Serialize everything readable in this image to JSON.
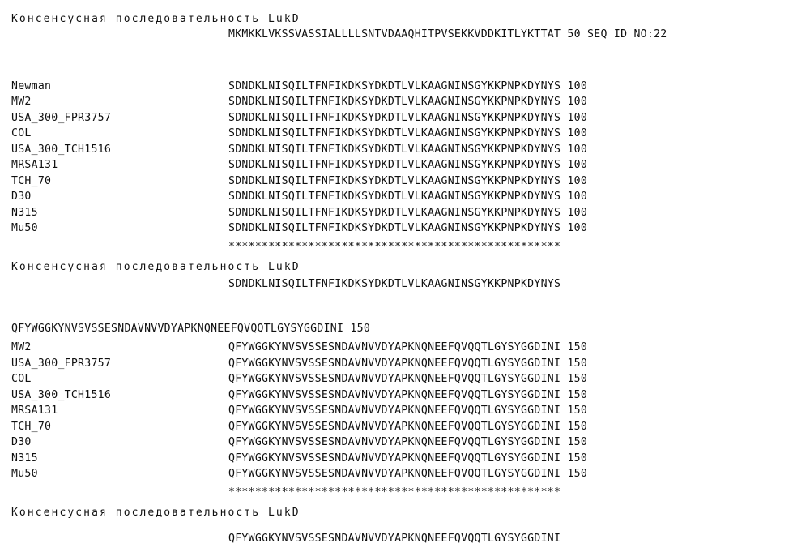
{
  "document": {
    "type": "sequence-alignment",
    "protein": "LukD",
    "consensus_heading": "Консенсусная последовательность LukD",
    "conservation_marker": "*",
    "conservation_line_length": 50
  },
  "block1": {
    "heading": "Консенсусная последовательность LukD",
    "header_sequence": "MKMKKLVKSSVASSIALLLLSNTVDAAQHITPVSEKKVDDKITLYKTTAT",
    "header_position": "50",
    "header_annotation": "SEQ ID NO:22",
    "rows": [
      {
        "label": "Newman",
        "sequence": "SDNDKLNISQILTFNFIKDKSYDKDTLVLKAAGNINSGYKKPNPKDYNYS",
        "position": "100"
      },
      {
        "label": "MW2",
        "sequence": "SDNDKLNISQILTFNFIKDKSYDKDTLVLKAAGNINSGYKKPNPKDYNYS",
        "position": "100"
      },
      {
        "label": "USA_300_FPR3757",
        "sequence": "SDNDKLNISQILTFNFIKDKSYDKDTLVLKAAGNINSGYKKPNPKDYNYS",
        "position": "100"
      },
      {
        "label": "COL",
        "sequence": "SDNDKLNISQILTFNFIKDKSYDKDTLVLKAAGNINSGYKKPNPKDYNYS",
        "position": "100"
      },
      {
        "label": "USA_300_TCH1516",
        "sequence": "SDNDKLNISQILTFNFIKDKSYDKDTLVLKAAGNINSGYKKPNPKDYNYS",
        "position": "100"
      },
      {
        "label": "MRSA131",
        "sequence": "SDNDKLNISQILTFNFIKDKSYDKDTLVLKAAGNINSGYKKPNPKDYNYS",
        "position": "100"
      },
      {
        "label": "TCH_70",
        "sequence": "SDNDKLNISQILTFNFIKDKSYDKDTLVLKAAGNINSGYKKPNPKDYNYS",
        "position": "100"
      },
      {
        "label": "D30",
        "sequence": "SDNDKLNISQILTFNFIKDKSYDKDTLVLKAAGNINSGYKKPNPKDYNYS",
        "position": "100"
      },
      {
        "label": "N315",
        "sequence": "SDNDKLNISQILTFNFIKDKSYDKDTLVLKAAGNINSGYKKPNPKDYNYS",
        "position": "100"
      },
      {
        "label": "Mu50",
        "sequence": "SDNDKLNISQILTFNFIKDKSYDKDTLVLKAAGNINSGYKKPNPKDYNYS",
        "position": "100"
      }
    ],
    "conservation": "**************************************************",
    "consensus_heading_bottom": "Консенсусная последовательность LukD",
    "consensus_sequence": "SDNDKLNISQILTFNFIKDKSYDKDTLVLKAAGNINSGYKKPNPKDYNYS"
  },
  "block2": {
    "header_sequence": "QFYWGGKYNVSVSSESNDAVNVVDYAPKNQNEEFQVQQTLGYSYGGDINI",
    "header_position": "150",
    "rows": [
      {
        "label": "MW2",
        "sequence": "QFYWGGKYNVSVSSESNDAVNVVDYAPKNQNEEFQVQQTLGYSYGGDINI",
        "position": "150"
      },
      {
        "label": "USA_300_FPR3757",
        "sequence": "QFYWGGKYNVSVSSESNDAVNVVDYAPKNQNEEFQVQQTLGYSYGGDINI",
        "position": "150"
      },
      {
        "label": "COL",
        "sequence": "QFYWGGKYNVSVSSESNDAVNVVDYAPKNQNEEFQVQQTLGYSYGGDINI",
        "position": "150"
      },
      {
        "label": "USA_300_TCH1516",
        "sequence": "QFYWGGKYNVSVSSESNDAVNVVDYAPKNQNEEFQVQQTLGYSYGGDINI",
        "position": "150"
      },
      {
        "label": "MRSA131",
        "sequence": "QFYWGGKYNVSVSSESNDAVNVVDYAPKNQNEEFQVQQTLGYSYGGDINI",
        "position": "150"
      },
      {
        "label": "TCH_70",
        "sequence": "QFYWGGKYNVSVSSESNDAVNVVDYAPKNQNEEFQVQQTLGYSYGGDINI",
        "position": "150"
      },
      {
        "label": "D30",
        "sequence": "QFYWGGKYNVSVSSESNDAVNVVDYAPKNQNEEFQVQQTLGYSYGGDINI",
        "position": "150"
      },
      {
        "label": "N315",
        "sequence": "QFYWGGKYNVSVSSESNDAVNVVDYAPKNQNEEFQVQQTLGYSYGGDINI",
        "position": "150"
      },
      {
        "label": "Mu50",
        "sequence": "QFYWGGKYNVSVSSESNDAVNVVDYAPKNQNEEFQVQQTLGYSYGGDINI",
        "position": "150"
      }
    ],
    "conservation": "**************************************************",
    "consensus_heading_bottom": "Консенсусная последовательность LukD",
    "consensus_sequence": "QFYWGGKYNVSVSSESNDAVNVVDYAPKNQNEEFQVQQTLGYSYGGDINI"
  }
}
